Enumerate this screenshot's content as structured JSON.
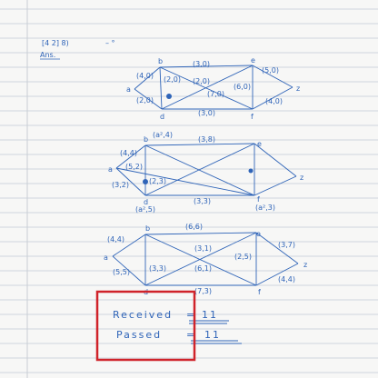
{
  "header": {
    "ref": "[4 2] 8)",
    "ans_label": "Ans."
  },
  "graph1": {
    "nodes": {
      "a": "a",
      "b": "b",
      "d": "d",
      "e": "e",
      "f": "f",
      "z": "z"
    },
    "labels": [
      "(4,0)",
      "(2,0)",
      "(2,0)",
      "(3,0)",
      "(2,0)",
      "(7,0)",
      "(6,0)",
      "(3,0)",
      "(5,0)",
      "(4,0)"
    ]
  },
  "graph2": {
    "nodes": {
      "a": "a",
      "b": "b",
      "d": "d",
      "e": "e",
      "f": "f",
      "z": "z"
    },
    "labels": [
      "(a²,4)",
      "(3,8)",
      "(4,4)",
      "(5,2)",
      "(2,3)",
      "(3,3)",
      "(3,2)",
      "(a²,5)",
      "(a²,3)"
    ]
  },
  "graph3": {
    "nodes": {
      "a": "a",
      "b": "b",
      "d": "d",
      "e": "e",
      "f": "f",
      "z": "z"
    },
    "labels": [
      "(4,4)",
      "(6,6)",
      "(3,1)",
      "(2,5)",
      "(3,7)",
      "(5,5)",
      "(3,3)",
      "(6,1)",
      "(7,3)",
      "(4,4)"
    ]
  },
  "result": {
    "received_label": "Received",
    "received_value": "11",
    "passed_label": "Passed",
    "passed_value": "11"
  },
  "colors": {
    "ink": "#2f64b8",
    "highlight_box": "#d0232a",
    "ruled_line": "#cfd6df",
    "margin_line": "#c9cdd4"
  }
}
